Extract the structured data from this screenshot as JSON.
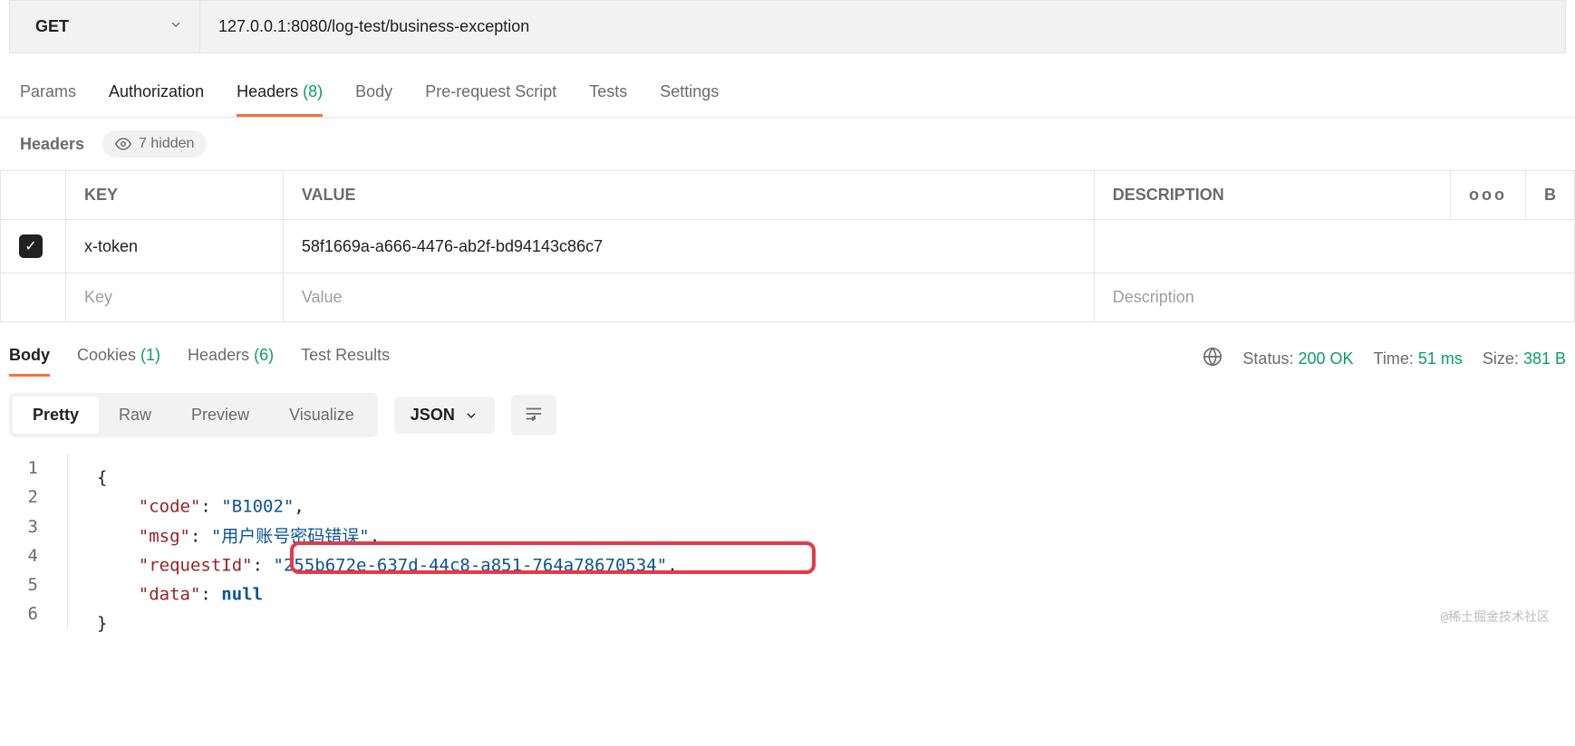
{
  "request": {
    "method": "GET",
    "url": "127.0.0.1:8080/log-test/business-exception"
  },
  "request_tabs": {
    "params": "Params",
    "authorization": "Authorization",
    "headers": "Headers",
    "headers_count": "(8)",
    "body": "Body",
    "prerequest": "Pre-request Script",
    "tests": "Tests",
    "settings": "Settings"
  },
  "headers_section": {
    "label": "Headers",
    "hidden": "7 hidden",
    "columns": {
      "key": "KEY",
      "value": "VALUE",
      "description": "DESCRIPTION",
      "more": "ooo",
      "b": "B"
    },
    "rows": [
      {
        "key": "x-token",
        "value": "58f1669a-a666-4476-ab2f-bd94143c86c7",
        "description": ""
      }
    ],
    "placeholders": {
      "key": "Key",
      "value": "Value",
      "description": "Description"
    }
  },
  "response_tabs": {
    "body": "Body",
    "cookies": "Cookies",
    "cookies_count": "(1)",
    "headers": "Headers",
    "headers_count": "(6)",
    "test_results": "Test Results"
  },
  "response_status": {
    "status_label": "Status:",
    "status_value": "200 OK",
    "time_label": "Time:",
    "time_value": "51 ms",
    "size_label": "Size:",
    "size_value": "381 B"
  },
  "view_controls": {
    "pretty": "Pretty",
    "raw": "Raw",
    "preview": "Preview",
    "visualize": "Visualize",
    "format": "JSON"
  },
  "json_response": {
    "code_key": "\"code\"",
    "code_val": "\"B1002\"",
    "msg_key": "\"msg\"",
    "msg_val": "\"用户账号密码错误\"",
    "requestId_key": "\"requestId\"",
    "requestId_val": "\"255b672e-637d-44c8-a851-764a78670534\"",
    "data_key": "\"data\"",
    "data_val": "null"
  },
  "line_numbers": {
    "l1": "1",
    "l2": "2",
    "l3": "3",
    "l4": "4",
    "l5": "5",
    "l6": "6"
  },
  "watermark": "@稀土掘金技术社区"
}
